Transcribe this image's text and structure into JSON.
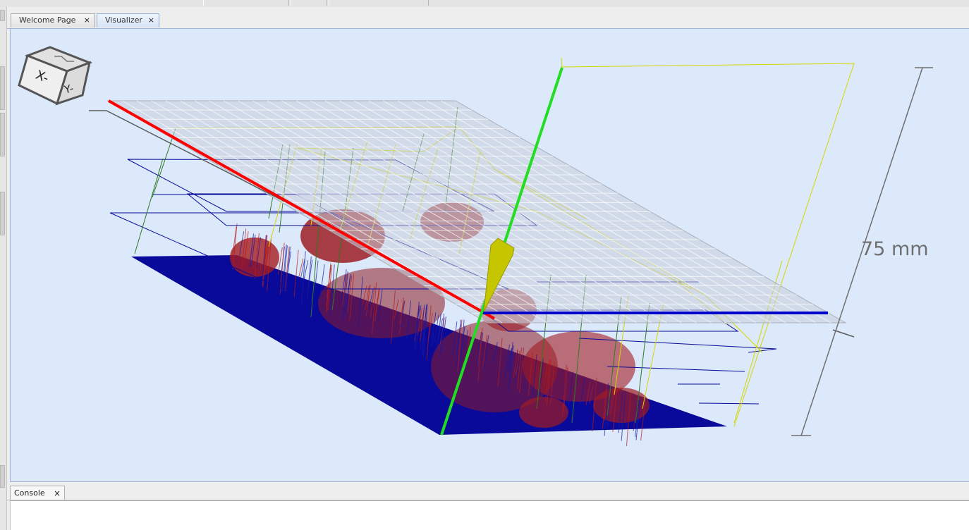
{
  "tabs": [
    {
      "label": "Welcome Page",
      "close": "×"
    },
    {
      "label": "Visualizer",
      "close": "×"
    }
  ],
  "view_cube": {
    "left_face": "X-",
    "right_face": "Y-"
  },
  "dimension_label": "75 mm",
  "console": {
    "tab_label": "Console",
    "close": "×"
  },
  "colors": {
    "viewport_bg": "#dbe9fb",
    "x_axis": "#ff0000",
    "y_axis": "#22dd22",
    "z_axis": "#0000cc",
    "toolpath_cut": "#0a0a9a",
    "toolpath_arc": "#b01818",
    "rapid_move": "#d8d800",
    "grid": "#c8cedb",
    "tool": "#c8c800"
  },
  "icons": [
    "view-cube-icon",
    "close-icon"
  ]
}
